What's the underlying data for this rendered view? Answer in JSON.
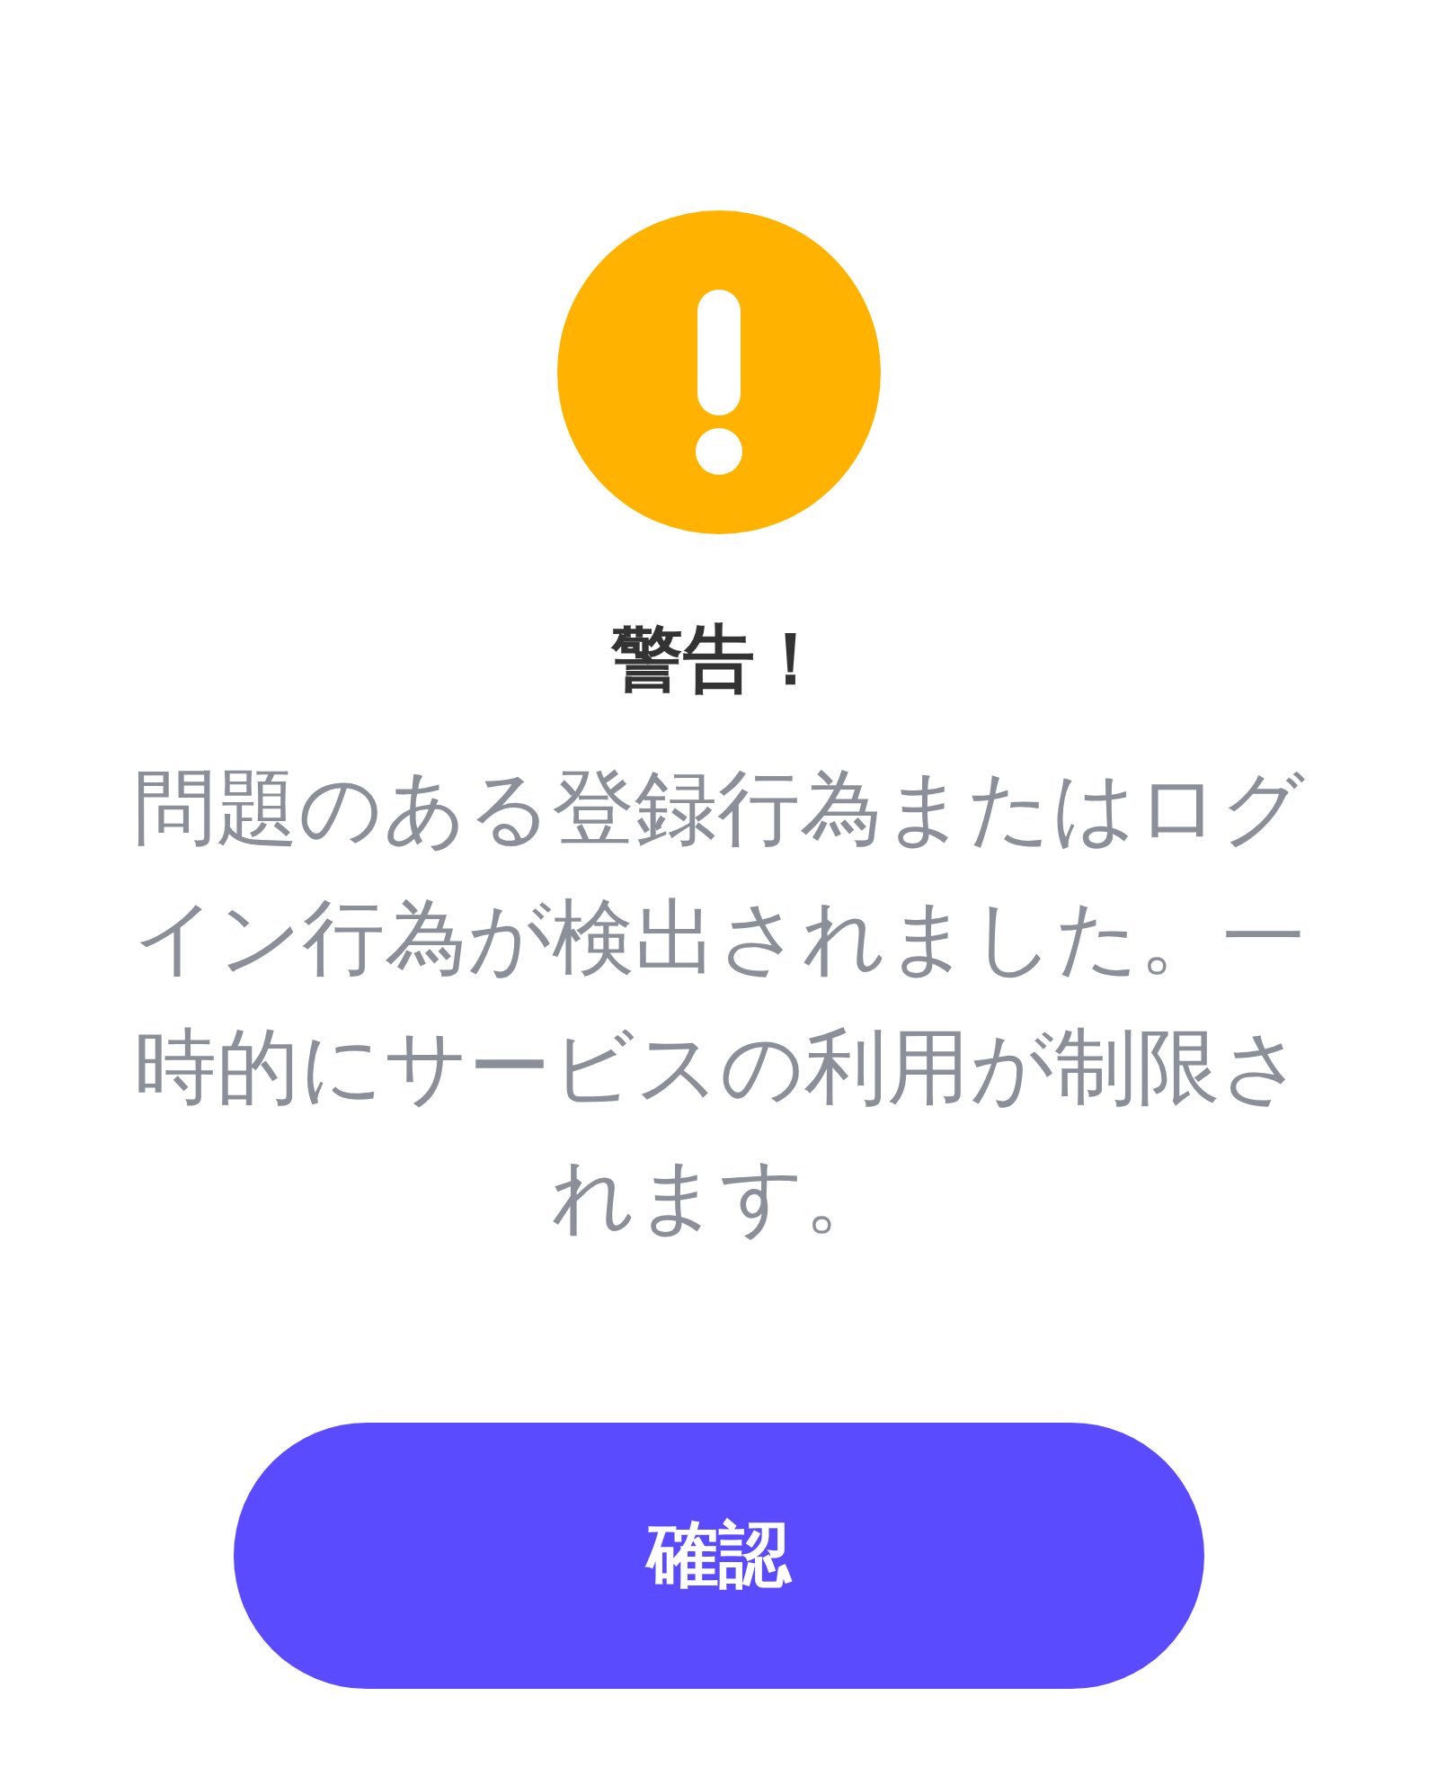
{
  "dialog": {
    "title": "警告！",
    "message": "問題のある登録行為またはログイン行為が検出されました。一時的にサービスの利用が制限されます。",
    "buttons": [
      {
        "label": "確認",
        "kind": "primary"
      }
    ]
  }
}
